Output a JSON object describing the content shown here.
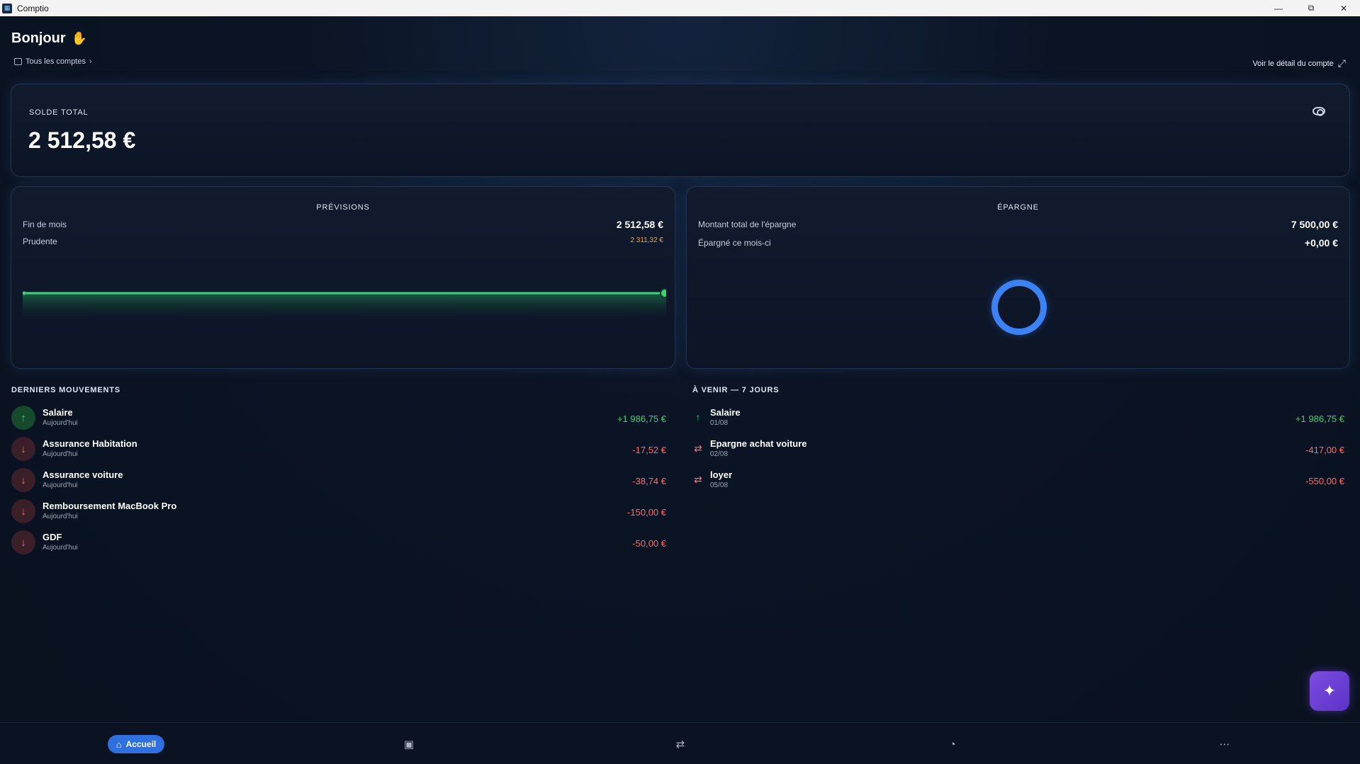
{
  "window": {
    "title": "Comptio",
    "controls": [
      "minimize-icon",
      "restore-icon",
      "close-icon"
    ]
  },
  "header": {
    "greeting": "Bonjour",
    "accounts_link": "Tous les comptes",
    "detail_link": "Voir le détail du compte"
  },
  "balance": {
    "label": "SOLDE TOTAL",
    "amount": "2 512,58 €"
  },
  "previsions": {
    "title": "PRÉVISIONS",
    "rows": [
      {
        "label": "Fin de mois",
        "value": "2 512,58 €"
      },
      {
        "label": "Prudente",
        "value": "2 311,32 €"
      }
    ]
  },
  "epargne": {
    "title": "ÉPARGNE",
    "rows": [
      {
        "label": "Montant total de l'épargne",
        "value": "7 500,00 €"
      },
      {
        "label": "Épargné ce mois-ci",
        "value": "+0,00 €"
      }
    ]
  },
  "recent": {
    "title": "DERNIERS MOUVEMENTS",
    "items": [
      {
        "name": "Salaire",
        "date": "Aujourd'hui",
        "amount": "+1 986,75 €",
        "direction": "up"
      },
      {
        "name": "Assurance Habitation",
        "date": "Aujourd'hui",
        "amount": "-17,52 €",
        "direction": "down"
      },
      {
        "name": "Assurance voiture",
        "date": "Aujourd'hui",
        "amount": "-38,74 €",
        "direction": "down"
      },
      {
        "name": "Remboursement MacBook Pro",
        "date": "Aujourd'hui",
        "amount": "-150,00 €",
        "direction": "down"
      },
      {
        "name": "GDF",
        "date": "Aujourd'hui",
        "amount": "-50,00 €",
        "direction": "down"
      }
    ]
  },
  "upcoming": {
    "title": "À VENIR — 7 JOURS",
    "items": [
      {
        "name": "Salaire",
        "date": "01/08",
        "amount": "+1 986,75 €",
        "icon": "arrow-up-icon"
      },
      {
        "name": "Epargne achat voiture",
        "date": "02/08",
        "amount": "-417,00 €",
        "icon": "repeat-icon"
      },
      {
        "name": "loyer",
        "date": "05/08",
        "amount": "-550,00 €",
        "icon": "repeat-icon"
      }
    ]
  },
  "nav": {
    "home_label": "Accueil"
  },
  "colors": {
    "positive": "#3fd17a",
    "negative": "#ff6b6b",
    "accent": "#2f6fe0",
    "warning": "#f5a623",
    "assistant": "#7c4de0"
  }
}
